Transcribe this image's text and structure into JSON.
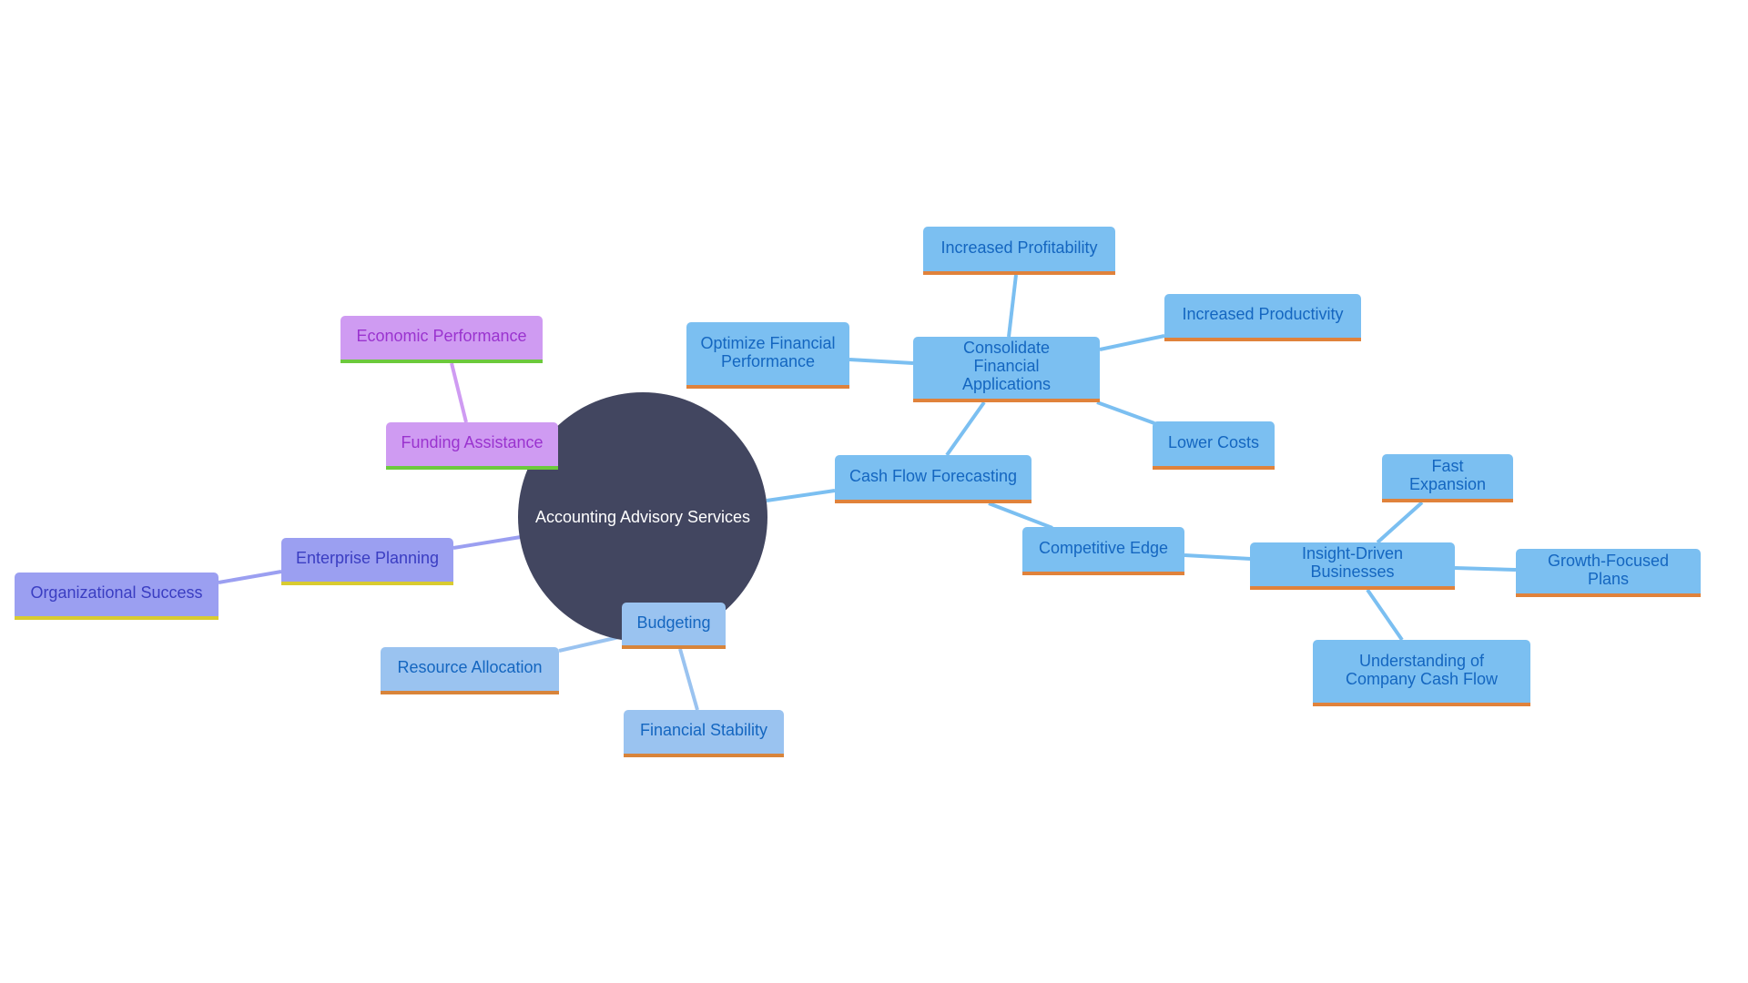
{
  "title": "Accounting Advisory Services",
  "colors": {
    "root": "#424660",
    "blue_fill": "#7bbff1",
    "blue_text": "#1466c0",
    "orange_underline": "#e0823b",
    "light_blue_fill": "#9ac3f0",
    "purple_fill": "#cf9bf2",
    "purple_text": "#9a33cf",
    "green_underline": "#6cc93c",
    "periwinkle_fill": "#9b9ff1",
    "periwinkle_text": "#3a3dc2",
    "yellow_underline": "#d9cb30"
  },
  "root": {
    "label": "Accounting Advisory Services"
  },
  "nodes": [
    {
      "id": "economic-performance",
      "label": "Economic Performance",
      "parent": "funding-assistance",
      "theme": "purple"
    },
    {
      "id": "funding-assistance",
      "label": "Funding Assistance",
      "parent": "root",
      "theme": "purple"
    },
    {
      "id": "enterprise-planning",
      "label": "Enterprise Planning",
      "parent": "root",
      "theme": "periwinkle"
    },
    {
      "id": "organizational-success",
      "label": "Organizational Success",
      "parent": "enterprise-planning",
      "theme": "periwinkle"
    },
    {
      "id": "budgeting",
      "label": "Budgeting",
      "parent": "root",
      "theme": "light-blue"
    },
    {
      "id": "resource-allocation",
      "label": "Resource Allocation",
      "parent": "budgeting",
      "theme": "light-blue"
    },
    {
      "id": "financial-stability",
      "label": "Financial Stability",
      "parent": "budgeting",
      "theme": "light-blue"
    },
    {
      "id": "cash-flow-forecasting",
      "label": "Cash Flow Forecasting",
      "parent": "root",
      "theme": "blue"
    },
    {
      "id": "consolidate-financial-applications",
      "label": "Consolidate Financial Applications",
      "parent": "cash-flow-forecasting",
      "theme": "blue"
    },
    {
      "id": "increased-profitability",
      "label": "Increased Profitability",
      "parent": "consolidate-financial-applications",
      "theme": "blue"
    },
    {
      "id": "optimize-financial-performance",
      "label": "Optimize Financial Performance",
      "parent": "consolidate-financial-applications",
      "theme": "blue"
    },
    {
      "id": "increased-productivity",
      "label": "Increased Productivity",
      "parent": "consolidate-financial-applications",
      "theme": "blue"
    },
    {
      "id": "lower-costs",
      "label": "Lower Costs",
      "parent": "consolidate-financial-applications",
      "theme": "blue"
    },
    {
      "id": "competitive-edge",
      "label": "Competitive Edge",
      "parent": "cash-flow-forecasting",
      "theme": "blue"
    },
    {
      "id": "insight-driven-businesses",
      "label": "Insight-Driven Businesses",
      "parent": "competitive-edge",
      "theme": "blue"
    },
    {
      "id": "fast-expansion",
      "label": "Fast Expansion",
      "parent": "insight-driven-businesses",
      "theme": "blue"
    },
    {
      "id": "growth-focused-plans",
      "label": "Growth-Focused Plans",
      "parent": "insight-driven-businesses",
      "theme": "blue"
    },
    {
      "id": "understanding-of-company-cash-flow",
      "label": "Understanding of Company Cash Flow",
      "parent": "insight-driven-businesses",
      "theme": "blue"
    }
  ]
}
